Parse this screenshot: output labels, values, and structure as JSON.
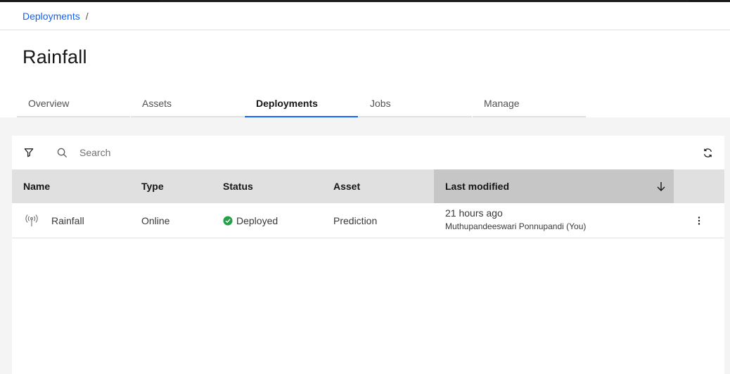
{
  "breadcrumb": {
    "root": "Deployments",
    "separator": "/"
  },
  "page": {
    "title": "Rainfall"
  },
  "tabs": [
    {
      "label": "Overview"
    },
    {
      "label": "Assets"
    },
    {
      "label": "Deployments",
      "active": true
    },
    {
      "label": "Jobs"
    },
    {
      "label": "Manage"
    }
  ],
  "toolbar": {
    "filter_icon": "filter-icon",
    "search_icon": "search-icon",
    "search_placeholder": "Search",
    "refresh_icon": "refresh-icon"
  },
  "table": {
    "headers": {
      "name": "Name",
      "type": "Type",
      "status": "Status",
      "asset": "Asset",
      "last_modified": "Last modified"
    },
    "sort_column": "last_modified",
    "sort_direction": "descending",
    "rows": [
      {
        "icon": "online-deployment-icon",
        "name": "Rainfall",
        "type": "Online",
        "status": "Deployed",
        "status_icon": "check-circle-icon",
        "status_color": "#24a148",
        "asset": "Prediction",
        "modified_time": "21 hours ago",
        "modified_by": "Muthupandeeswari Ponnupandi (You)"
      }
    ]
  },
  "colors": {
    "accent": "#0f62fe",
    "header_bg": "#e0e0e0",
    "sorted_header_bg": "#c6c6c6",
    "page_bg": "#f4f4f4"
  }
}
